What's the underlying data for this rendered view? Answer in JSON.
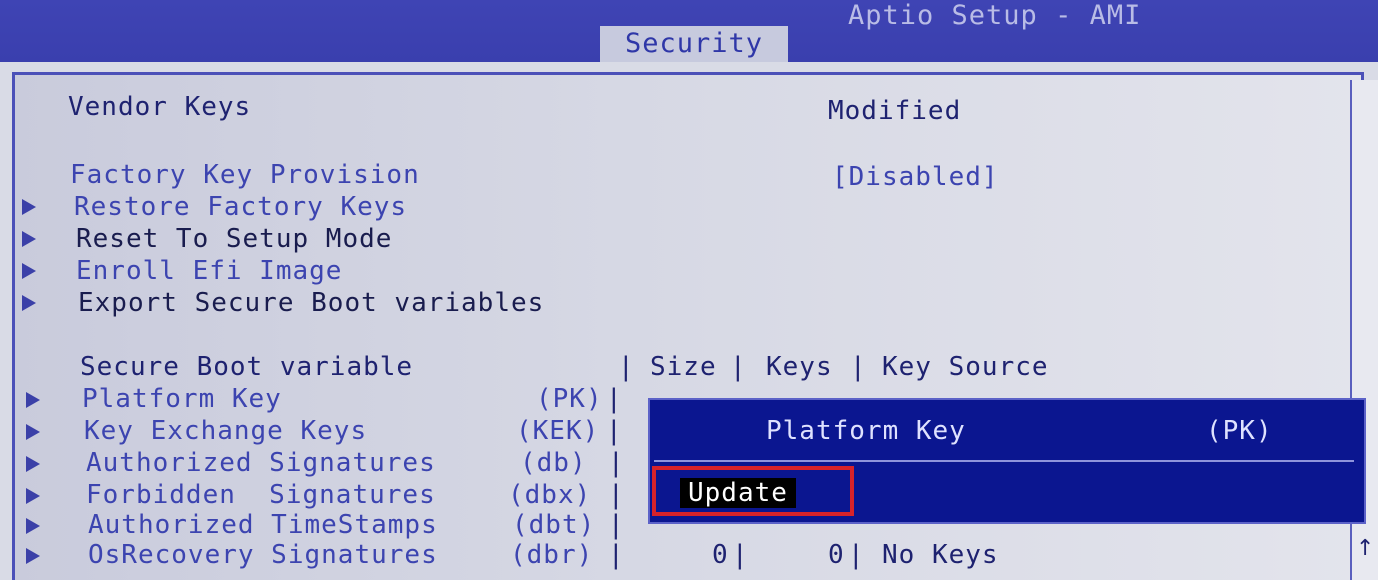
{
  "app_title": "Aptio Setup - AMI",
  "tab": "Security",
  "vendor_keys": {
    "label": "Vendor Keys",
    "value": "Modified"
  },
  "factory_key_provision": {
    "label": "Factory Key Provision",
    "value": "[Disabled]"
  },
  "menu_items": [
    "Restore Factory Keys",
    "Reset To Setup Mode",
    "Enroll Efi Image",
    "Export Secure Boot variables"
  ],
  "variables_header": {
    "variable": "Secure Boot variable",
    "size": "Size",
    "keys": "Keys",
    "source": "Key Source"
  },
  "variables": [
    {
      "name": "Platform Key",
      "abbr": "(PK)"
    },
    {
      "name": "Key Exchange Keys",
      "abbr": "(KEK)"
    },
    {
      "name": "Authorized Signatures",
      "abbr": "(db)"
    },
    {
      "name": "Forbidden  Signatures",
      "abbr": "(dbx)"
    },
    {
      "name": "Authorized TimeStamps",
      "abbr": "(dbt)"
    },
    {
      "name": "OsRecovery Signatures",
      "abbr": "(dbr)",
      "size": "0",
      "keys": "0",
      "source": "No Keys"
    }
  ],
  "popup": {
    "title": "Platform Key",
    "subtitle": "(PK)",
    "option": "Update"
  },
  "scroll_indicator": "↑"
}
